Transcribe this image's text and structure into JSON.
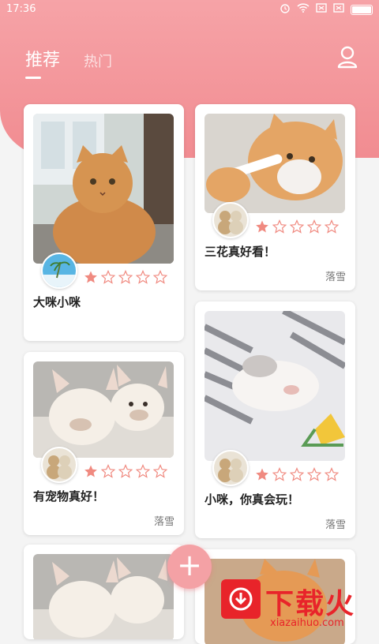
{
  "status_bar": {
    "time": "17:36"
  },
  "tabs": [
    {
      "label": "推荐",
      "active": true
    },
    {
      "label": "热门",
      "active": false
    }
  ],
  "posts": [
    {
      "title": "大咪小咪",
      "author": "",
      "rating": 1,
      "max_rating": 5,
      "image": "orange cat sitting by window",
      "avatar": "beach-avatar"
    },
    {
      "title": "三花真好看！",
      "author": "落雪",
      "rating": 1,
      "max_rating": 5,
      "image": "orange and white cat biting toy",
      "avatar": "teddy-bears-avatar"
    },
    {
      "title": "有宠物真好！",
      "author": "落雪",
      "rating": 1,
      "max_rating": 5,
      "image": "french bulldog puppies",
      "avatar": "teddy-bears-avatar"
    },
    {
      "title": "小咪，你真会玩！",
      "author": "落雪",
      "rating": 1,
      "max_rating": 5,
      "image": "white kitten sleeping on blanket",
      "avatar": "teddy-bears-avatar"
    },
    {
      "title": "",
      "author": "",
      "image": "french bulldog puppies"
    },
    {
      "title": "",
      "author": "",
      "image": "orange cat"
    }
  ],
  "fab": {
    "label": "+"
  },
  "watermark": {
    "text": "下载火",
    "sub": "xiazaihuo.com"
  },
  "colors": {
    "accent": "#f18c91",
    "star": "#f08a80"
  }
}
